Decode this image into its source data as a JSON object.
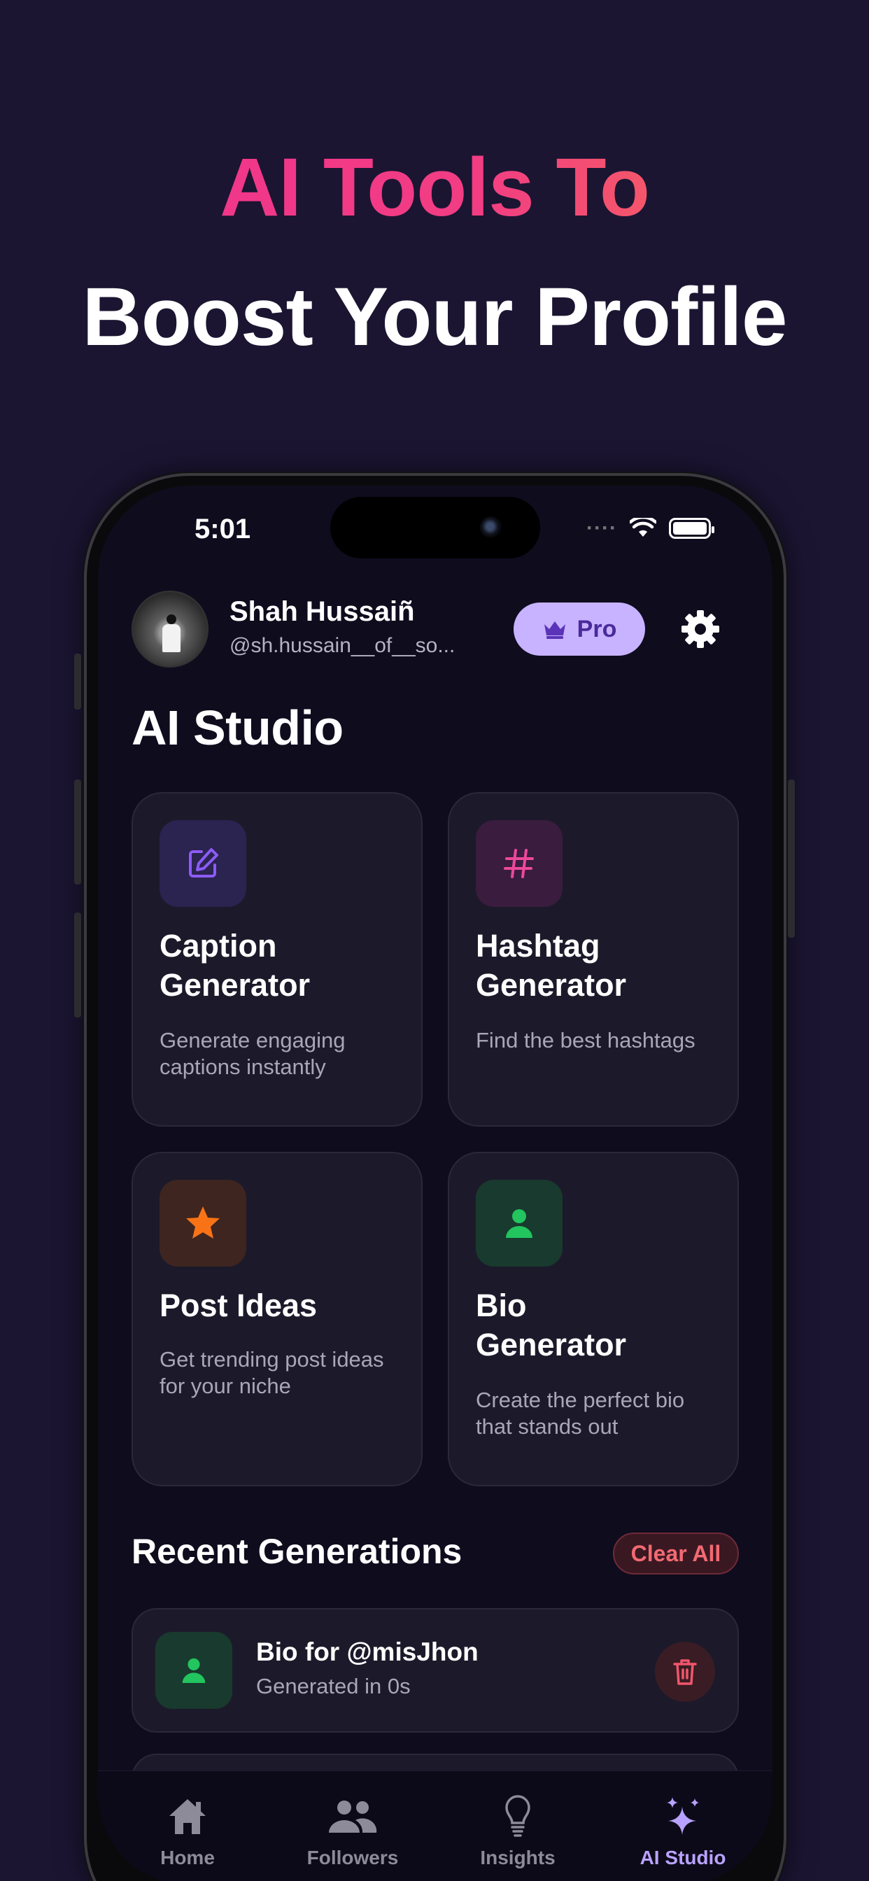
{
  "headline": {
    "line1": "AI Tools To",
    "line2": "Boost Your Profile"
  },
  "status_bar": {
    "time": "5:01"
  },
  "profile": {
    "name": "Shah Hussaiñ",
    "handle": "@sh.hussain__of__so...",
    "pro_label": "Pro"
  },
  "page_title": "AI Studio",
  "tools": [
    {
      "title": "Caption Generator",
      "description": "Generate engaging captions instantly",
      "icon": "edit-icon",
      "color": "#8b5cf6"
    },
    {
      "title": "Hashtag Generator",
      "description": "Find the best hashtags",
      "icon": "hashtag-icon",
      "color": "#ec4899"
    },
    {
      "title": "Post Ideas",
      "description": "Get trending post ideas for your niche",
      "icon": "star-icon",
      "color": "#f97316"
    },
    {
      "title": "Bio Generator",
      "description": "Create the perfect bio that stands out",
      "icon": "person-icon",
      "color": "#22c55e"
    }
  ],
  "recent": {
    "title": "Recent Generations",
    "clear_label": "Clear All",
    "items": [
      {
        "title": "Bio for @misJhon",
        "subtitle": "Generated in 0s",
        "icon": "person-icon"
      }
    ]
  },
  "tabs": [
    {
      "label": "Home",
      "icon": "home-icon",
      "active": false
    },
    {
      "label": "Followers",
      "icon": "followers-icon",
      "active": false
    },
    {
      "label": "Insights",
      "icon": "lightbulb-icon",
      "active": false
    },
    {
      "label": "AI Studio",
      "icon": "sparkles-icon",
      "active": true
    }
  ],
  "colors": {
    "background": "#1b1532",
    "screen": "#0f0c1e",
    "accent": "#c7b3ff",
    "danger": "#f26a72"
  }
}
